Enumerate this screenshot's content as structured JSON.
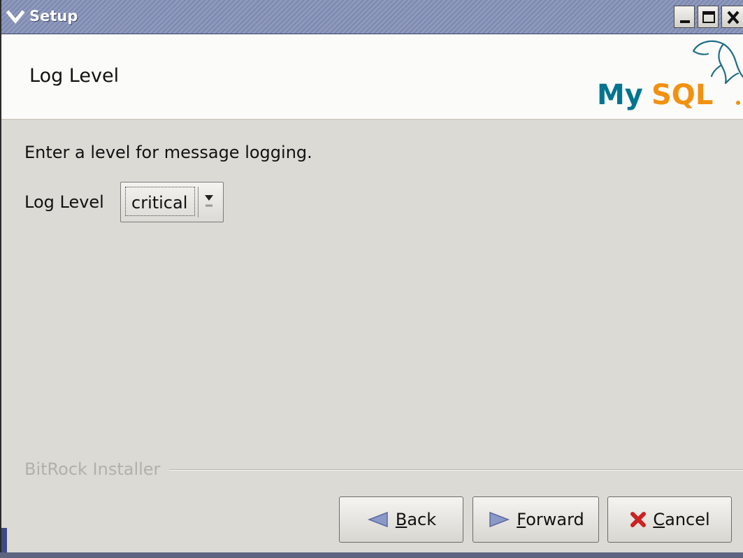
{
  "window": {
    "title": "Setup",
    "menu_icon": "chevron-down-icon",
    "controls": [
      "minimize-icon",
      "maximize-icon",
      "close-icon"
    ]
  },
  "header": {
    "title": "Log Level",
    "logo_text": "MySQL"
  },
  "content": {
    "description": "Enter a level for message logging.",
    "log_level_label": "Log Level",
    "log_level_value": "critical"
  },
  "footer": {
    "installer_label": "BitRock Installer",
    "back_label": "Back",
    "forward_label": "Forward",
    "cancel_label": "Cancel"
  },
  "colors": {
    "titlebar": "#8e99bd",
    "window_bg": "#dcdad5",
    "header_bg": "#fbfbf9",
    "mysql_blue": "#00758f",
    "mysql_orange": "#f29111",
    "cancel_red": "#cc2222"
  }
}
